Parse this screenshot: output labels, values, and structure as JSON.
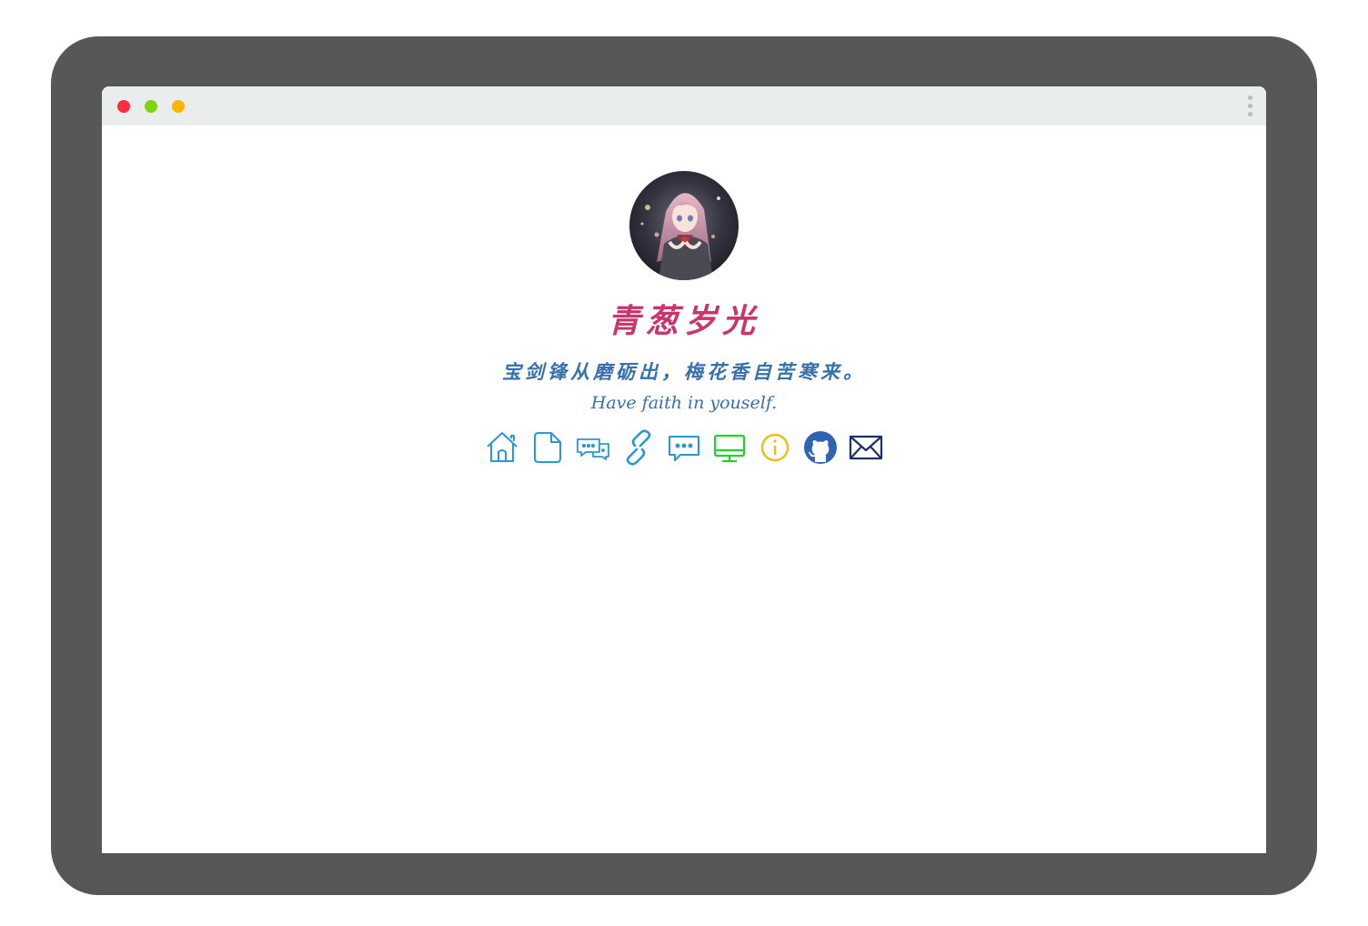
{
  "window": {
    "controls": [
      "close",
      "minimize",
      "maximize"
    ],
    "control_colors": {
      "close": "#fd2e3a",
      "minimize": "#7fd40f",
      "maximize": "#ffb400"
    },
    "menu_icon": "kebab-menu-icon"
  },
  "profile": {
    "avatar_icon": "anime-avatar-image",
    "title": "青葱岁光",
    "title_color": "#c9356c",
    "motto_cn": "宝剑锋从磨砺出，梅花香自苦寒来。",
    "motto_en": "Have faith in youself.",
    "motto_color": "#3670ad"
  },
  "social_links": [
    {
      "icon": "home-icon",
      "color": "#2a97d7"
    },
    {
      "icon": "document-icon",
      "color": "#2a97d7"
    },
    {
      "icon": "chat-bubbles-icon",
      "color": "#2a97d7"
    },
    {
      "icon": "link-icon",
      "color": "#2a97d7"
    },
    {
      "icon": "message-icon",
      "color": "#2a97d7"
    },
    {
      "icon": "monitor-icon",
      "color": "#22d12a"
    },
    {
      "icon": "info-icon",
      "color": "#f2b91b"
    },
    {
      "icon": "github-icon",
      "color": "#2f63b5"
    },
    {
      "icon": "mail-icon",
      "color": "#1e2f6e"
    }
  ]
}
